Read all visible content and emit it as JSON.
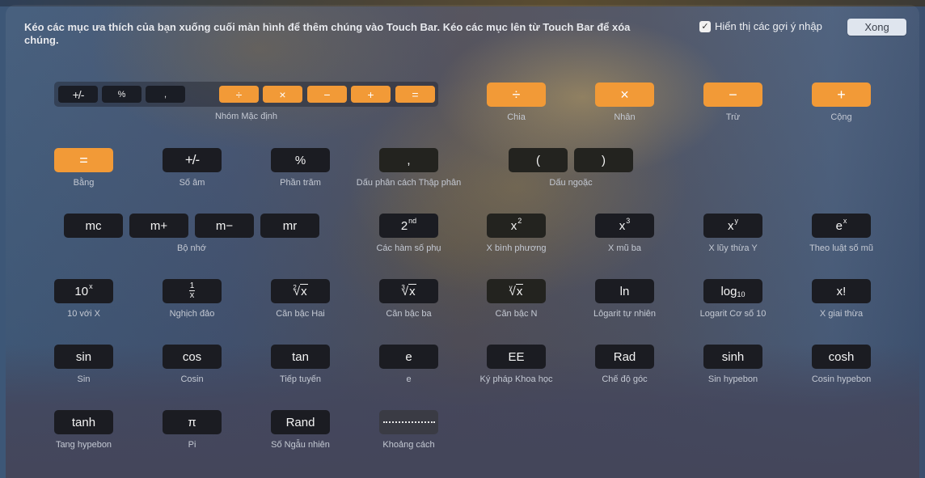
{
  "header": {
    "instructions": "Kéo các mục ưa thích của bạn xuống cuối màn hình để thêm chúng vào Touch Bar. Kéo các mục lên từ Touch Bar để xóa chúng.",
    "suggestions_label": "Hiển thị các gợi ý nhập",
    "suggestions_checked": true,
    "checkbox_glyph": "✓",
    "done_label": "Xong"
  },
  "colors": {
    "operator_orange": "#f29a37",
    "key_dark": "#1b1c22",
    "done_button": "#dfe5ee"
  },
  "default_group": {
    "label": "Nhóm Mặc định",
    "keys": [
      "+/-",
      "%",
      ",",
      "÷",
      "×",
      "−",
      "+",
      "="
    ]
  },
  "items": {
    "divide": {
      "key": "÷",
      "label": "Chia"
    },
    "multiply": {
      "key": "×",
      "label": "Nhân"
    },
    "subtract": {
      "key": "−",
      "label": "Trừ"
    },
    "add": {
      "key": "+",
      "label": "Cộng"
    },
    "equals": {
      "key": "=",
      "label": "Bằng"
    },
    "negate": {
      "key": "+/-",
      "label": "Số âm"
    },
    "percent": {
      "key": "%",
      "label": "Phần trăm"
    },
    "decimal": {
      "key": ",",
      "label": "Dấu phân cách Thập phân"
    },
    "parens": {
      "open": "(",
      "close": ")",
      "label": "Dấu ngoặc"
    },
    "memory": {
      "keys": [
        "mc",
        "m+",
        "m−",
        "mr"
      ],
      "label": "Bộ nhớ"
    },
    "second": {
      "base": "2",
      "sup": "nd",
      "label": "Các hàm số phụ"
    },
    "x_squared": {
      "base": "x",
      "sup": "2",
      "label": "X bình phương"
    },
    "x_cubed": {
      "base": "x",
      "sup": "3",
      "label": "X mũ ba"
    },
    "x_to_y": {
      "base": "x",
      "sup": "y",
      "label": "X lũy thừa Y"
    },
    "e_to_x": {
      "base": "e",
      "sup": "x",
      "label": "Theo luật số mũ"
    },
    "ten_to_x": {
      "base": "10",
      "sup": "x",
      "label": "10 với X"
    },
    "reciprocal": {
      "num": "1",
      "den": "x",
      "label": "Nghịch đảo"
    },
    "sqrt": {
      "index": "2",
      "radicand": "x",
      "label": "Căn bậc Hai"
    },
    "cbrt": {
      "index": "3",
      "radicand": "x",
      "label": "Căn bậc ba"
    },
    "nth_root": {
      "index": "y",
      "radicand": "x",
      "label": "Căn bậc N"
    },
    "ln": {
      "key": "ln",
      "label": "Lôgarit tự nhiên"
    },
    "log10": {
      "base": "log",
      "sub": "10",
      "label": "Logarit Cơ số 10"
    },
    "factorial": {
      "key": "x!",
      "label": "X giai thừa"
    },
    "sin": {
      "key": "sin",
      "label": "Sin"
    },
    "cos": {
      "key": "cos",
      "label": "Cosin"
    },
    "tan": {
      "key": "tan",
      "label": "Tiếp tuyến"
    },
    "e": {
      "key": "e",
      "label": "e"
    },
    "ee": {
      "key": "EE",
      "label": "Ký pháp Khoa học"
    },
    "rad": {
      "key": "Rad",
      "label": "Chế độ góc"
    },
    "sinh": {
      "key": "sinh",
      "label": "Sin hypebon"
    },
    "cosh": {
      "key": "cosh",
      "label": "Cosin hypebon"
    },
    "tanh": {
      "key": "tanh",
      "label": "Tang hypebon"
    },
    "pi": {
      "key": "π",
      "label": "Pi"
    },
    "rand": {
      "key": "Rand",
      "label": "Số Ngẫu nhiên"
    },
    "spacer": {
      "label": "Khoảng cách"
    }
  }
}
